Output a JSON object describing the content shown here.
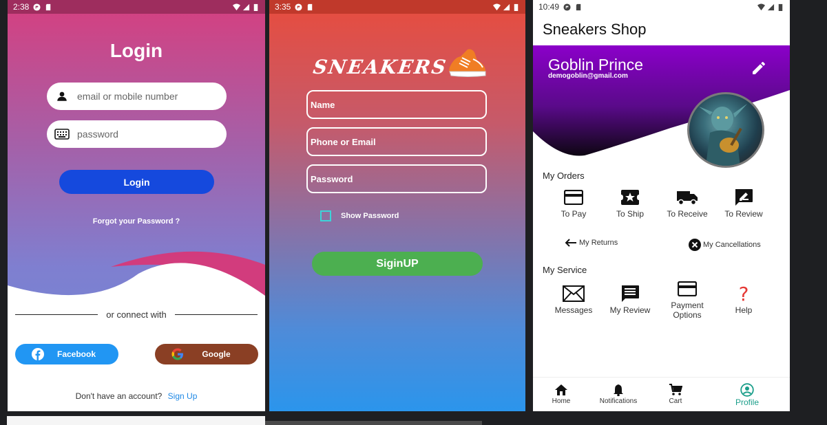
{
  "login": {
    "status": {
      "time": "2:38"
    },
    "title": "Login",
    "email_placeholder": "email or mobile number",
    "password_placeholder": "password",
    "login_button": "Login",
    "forgot_link": "Forgot your Password ?",
    "connect_text": "or connect with",
    "facebook_button": "Facebook",
    "google_button": "Google",
    "no_account_text": "Don't have an account?",
    "signup_link": "Sign Up",
    "colors": {
      "primary_button": "#1549dd",
      "facebook": "#2196f3",
      "google": "#8a3f24"
    }
  },
  "signup": {
    "status": {
      "time": "3:35"
    },
    "brand": "SNEAKERS",
    "name_placeholder": "Name",
    "contact_placeholder": "Phone or Email",
    "password_placeholder": "Password",
    "show_password_label": "Show Password",
    "signup_button": "SiginUP",
    "colors": {
      "signup_button": "#4caf50",
      "checkbox": "#3dd3d9"
    }
  },
  "profile": {
    "status": {
      "time": "10:49"
    },
    "app_title": "Sneakers Shop",
    "user_name": "Goblin Prince",
    "user_email": "demogoblin@gmail.com",
    "orders_title": "My Orders",
    "orders": [
      {
        "label": "To Pay",
        "icon": "credit-card-icon"
      },
      {
        "label": "To Ship",
        "icon": "star-box-icon"
      },
      {
        "label": "To Receive",
        "icon": "truck-icon"
      },
      {
        "label": "To Review",
        "icon": "rate-review-icon"
      }
    ],
    "returns_link": "My Returns",
    "cancellations_link": "My Cancellations",
    "service_title": "My Service",
    "services": [
      {
        "label": "Messages",
        "icon": "mail-icon"
      },
      {
        "label": "My Review",
        "icon": "comment-icon"
      },
      {
        "label": "Payment Options",
        "icon": "card-icon"
      },
      {
        "label": "Help",
        "icon": "question-icon"
      }
    ],
    "nav": [
      {
        "label": "Home",
        "icon": "home-icon"
      },
      {
        "label": "Notifications",
        "icon": "bell-icon"
      },
      {
        "label": "Cart",
        "icon": "cart-icon"
      },
      {
        "label": "Profile",
        "icon": "person-icon",
        "active": true
      }
    ],
    "colors": {
      "header_purple": "#8b00c9",
      "nav_active": "#1b9e8a"
    }
  }
}
